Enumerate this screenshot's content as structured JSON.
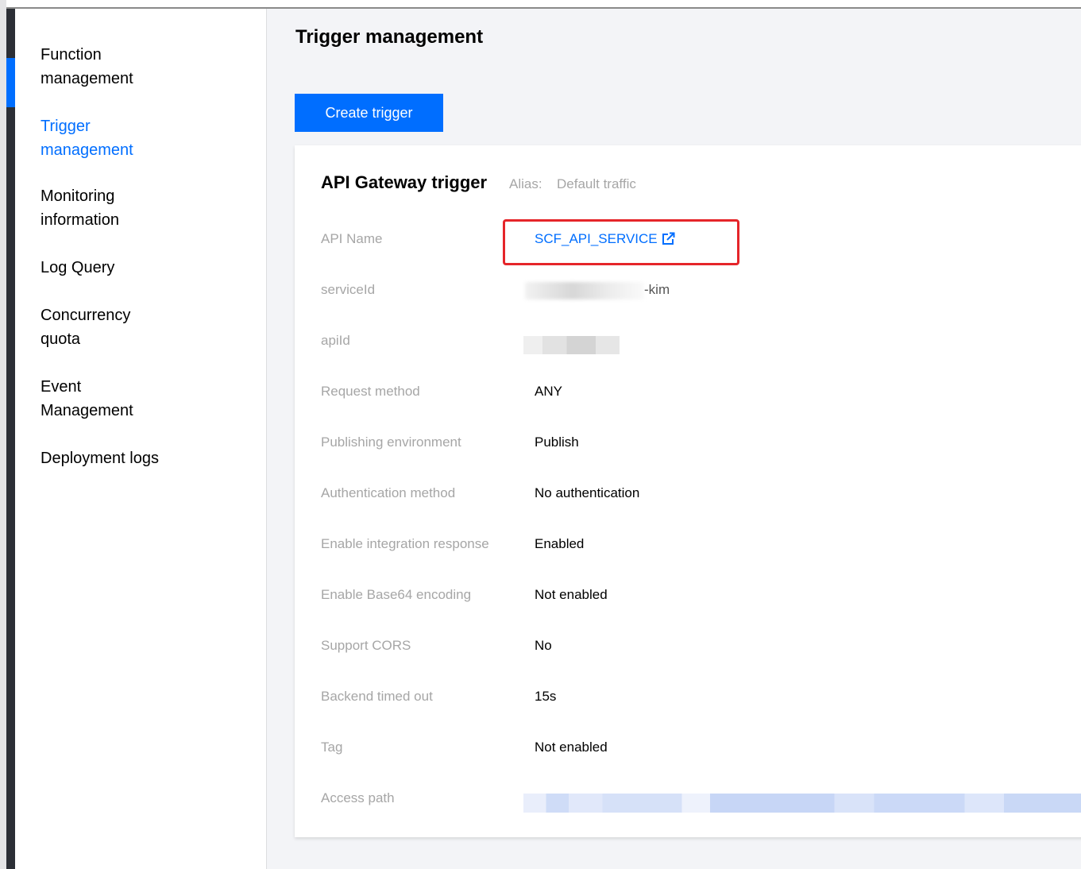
{
  "sidebar": {
    "items": [
      {
        "line1": "Function",
        "line2": "management"
      },
      {
        "line1": "Trigger",
        "line2": "management"
      },
      {
        "line1": "Monitoring",
        "line2": "information"
      },
      {
        "line1": "Log Query",
        "line2": ""
      },
      {
        "line1": "Concurrency",
        "line2": "quota"
      },
      {
        "line1": "Event",
        "line2": "Management"
      },
      {
        "line1": "Deployment logs",
        "line2": ""
      }
    ]
  },
  "main": {
    "title": "Trigger management",
    "create_button": "Create trigger"
  },
  "card": {
    "title": "API Gateway trigger",
    "alias_label": "Alias:",
    "alias_value": "Default traffic",
    "rows": [
      {
        "label": "API Name",
        "value": "SCF_API_SERVICE"
      },
      {
        "label": "serviceId",
        "value": "-kim"
      },
      {
        "label": "apiId",
        "value": ""
      },
      {
        "label": "Request method",
        "value": "ANY"
      },
      {
        "label": "Publishing environment",
        "value": "Publish"
      },
      {
        "label": "Authentication method",
        "value": "No authentication"
      },
      {
        "label": "Enable integration response",
        "value": "Enabled"
      },
      {
        "label": "Enable Base64 encoding",
        "value": "Not enabled"
      },
      {
        "label": "Support CORS",
        "value": "No"
      },
      {
        "label": "Backend timed out",
        "value": "15s"
      },
      {
        "label": "Tag",
        "value": "Not enabled"
      },
      {
        "label": "Access path",
        "value": ""
      }
    ]
  },
  "colors": {
    "accent": "#006eff",
    "highlight": "#e5252a",
    "label_gray": "#a6a6a6"
  },
  "icons": {
    "api_link": "external-link-icon"
  }
}
